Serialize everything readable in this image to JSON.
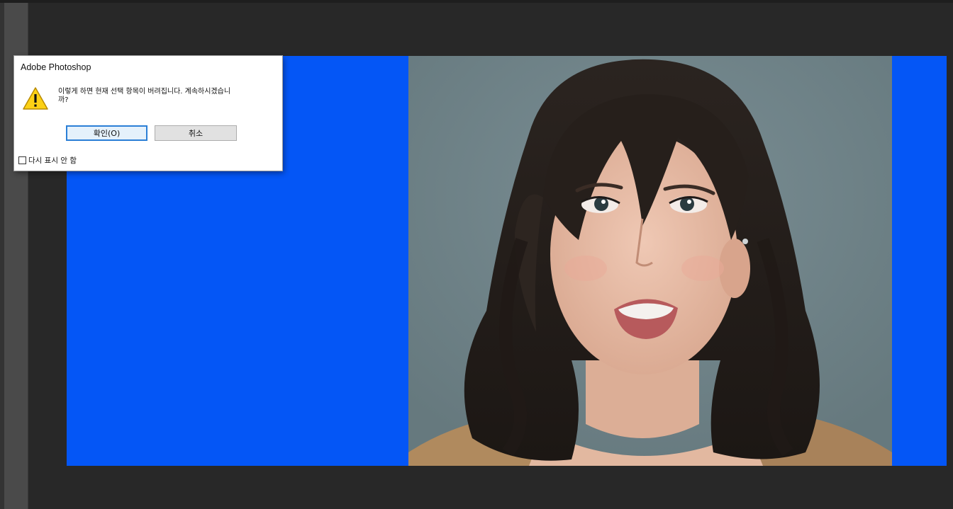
{
  "window": {
    "app": "Adobe Photoshop"
  },
  "colors": {
    "workspace": "#282828",
    "canvas_background": "#0456f6",
    "ok_focus_border": "#2b7fd6"
  },
  "dialog": {
    "title": "Adobe Photoshop",
    "icon": "warning-icon",
    "message": "이렇게 하면 현재 선택 항목이 버려집니다. 계속하시겠습니\n까?",
    "ok_label": "확인(O)",
    "cancel_label": "취소",
    "dont_show_label": "다시 표시 안 함",
    "dont_show_checked": false
  },
  "canvas": {
    "image": "photo-of-woman-portrait"
  }
}
